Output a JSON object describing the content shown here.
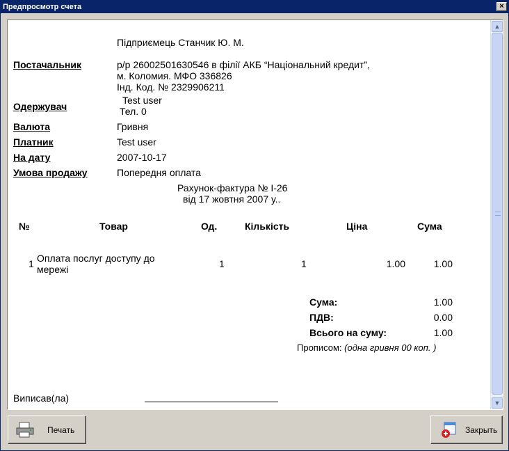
{
  "window": {
    "title": "Предпросмотр счета"
  },
  "invoice": {
    "seller_line": "Підприємець Станчик Ю. М.",
    "supplier": {
      "label": "Постачальник",
      "lines": [
        "р/р 26002501630546 в філії АКБ “Національний кредит”,",
        "м. Коломия. МФО 336826",
        "Інд. Код. № 2329906211"
      ]
    },
    "recipient": {
      "label": "Одержувач",
      "lines": [
        "Test user",
        "Тел. 0"
      ]
    },
    "currency": {
      "label": "Валюта",
      "value": "Гривня"
    },
    "payer": {
      "label": "Платник",
      "value": "Test user"
    },
    "date": {
      "label": "На дату",
      "value": "2007-10-17"
    },
    "terms": {
      "label": "Умова продажу",
      "value": "Попередня оплата"
    },
    "title_line1": "Рахунок-фактура № І-26",
    "title_line2": "від 17 жовтня 2007 у..",
    "table": {
      "headers": [
        "№",
        "Товар",
        "Од.",
        "Кількість",
        "Ціна",
        "Сума"
      ],
      "rows": [
        {
          "num": "1",
          "item": [
            "Оплата послуг доступу до",
            "мережі"
          ],
          "unit": "1",
          "qty": "1",
          "price": "1.00",
          "sum": "1.00"
        }
      ]
    },
    "totals": {
      "sum_label": "Сума:",
      "sum_value": "1.00",
      "vat_label": "ПДВ:",
      "vat_value": "0.00",
      "total_label": "Всього на суму:",
      "total_value": "1.00",
      "words_label": "Прописом:",
      "words_value": "(одна гривня 00 коп. )"
    },
    "issued_by": "Виписав(ла)"
  },
  "buttons": {
    "print": "Печать",
    "close": "Закрыть"
  }
}
